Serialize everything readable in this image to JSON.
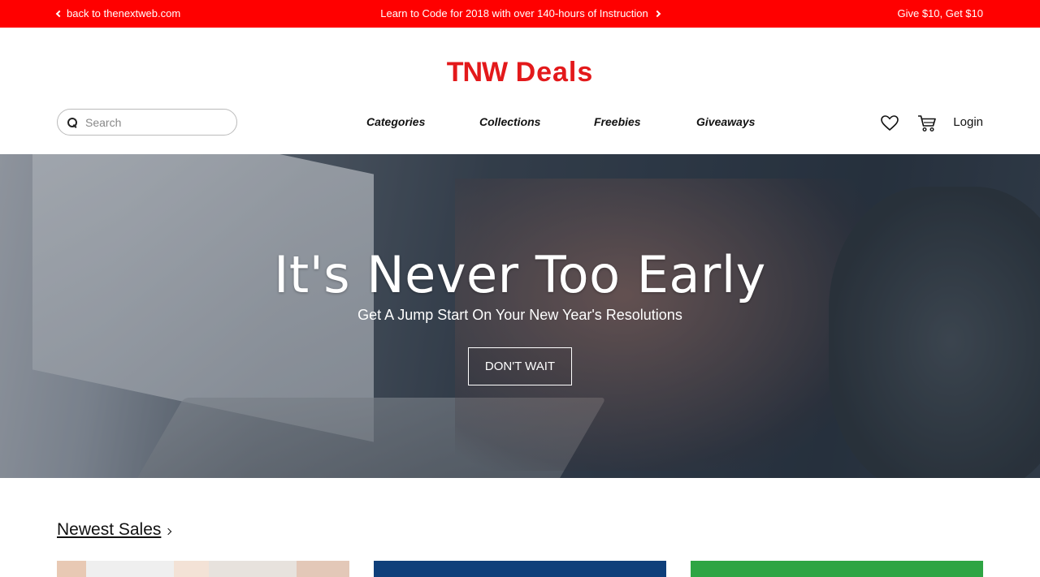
{
  "promo": {
    "back_label": "back to thenextweb.com",
    "center_label": "Learn to Code for 2018 with over 140-hours of Instruction",
    "give_label": "Give $10, Get $10"
  },
  "header": {
    "logo_tnw": "TNW",
    "logo_deals": "Deals",
    "search_placeholder": "Search",
    "nav": [
      "Categories",
      "Collections",
      "Freebies",
      "Giveaways"
    ],
    "login_label": "Login"
  },
  "hero": {
    "title": "It's Never Too Early",
    "subtitle": "Get A Jump Start On Your New Year's Resolutions",
    "cta_label": "DON'T WAIT"
  },
  "newest": {
    "title": "Newest Sales"
  },
  "colors": {
    "brand_red": "#ff0000",
    "logo_red": "#e3191b",
    "card_blue": "#0f3f7a",
    "card_green": "#2ea544"
  },
  "icons": [
    "chevron-left-icon",
    "chevron-right-icon",
    "search-icon",
    "heart-icon",
    "cart-icon"
  ]
}
